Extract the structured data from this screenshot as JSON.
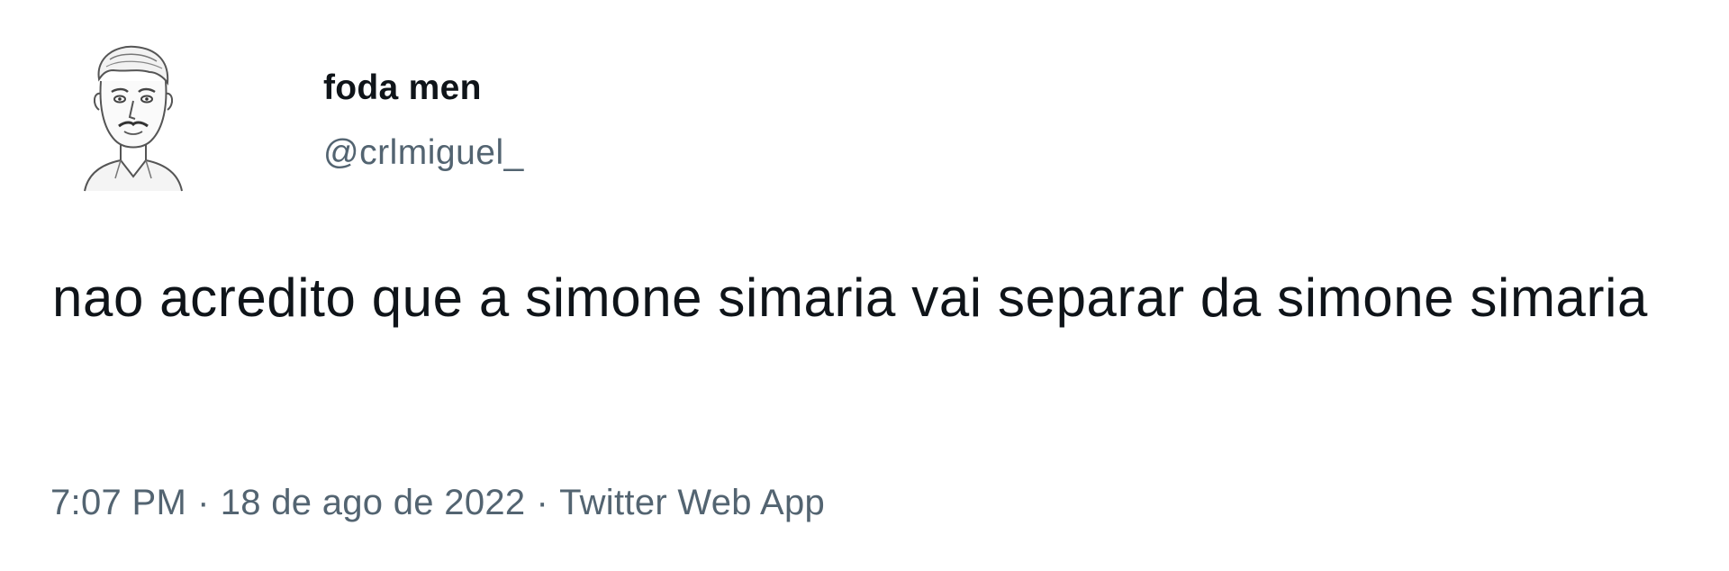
{
  "tweet": {
    "author": {
      "display_name": "foda men",
      "handle": "@crlmiguel_",
      "avatar_icon": "sketch-portrait-avatar"
    },
    "text": "nao acredito que a simone simaria vai separar da simone simaria",
    "meta": {
      "time": "7:07 PM",
      "separator": "·",
      "date": "18 de ago de 2022",
      "source": "Twitter Web App"
    }
  },
  "colors": {
    "text_primary": "#0f1419",
    "text_secondary": "#536471",
    "background": "#ffffff"
  }
}
